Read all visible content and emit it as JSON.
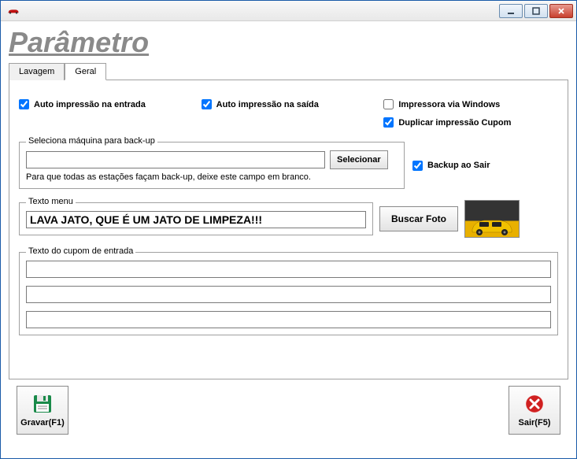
{
  "window": {
    "title": ""
  },
  "page_title": "Parâmetro",
  "tabs": {
    "lavagem": "Lavagem",
    "geral": "Geral"
  },
  "checks": {
    "auto_entrada": {
      "label": "Auto impressão na entrada",
      "checked": true
    },
    "auto_saida": {
      "label": "Auto impressão na saída",
      "checked": true
    },
    "imp_windows": {
      "label": "Impressora via Windows",
      "checked": false
    },
    "dup_cupom": {
      "label": "Duplicar impressão Cupom",
      "checked": true
    },
    "backup_sair": {
      "label": "Backup ao Sair",
      "checked": true
    }
  },
  "backup": {
    "legend": "Seleciona máquina para back-up",
    "value": "",
    "btn": "Selecionar",
    "hint": "Para que todas as  estações façam back-up,        deixe este campo em branco."
  },
  "texto_menu": {
    "legend": "Texto menu",
    "value": "LAVA JATO, QUE É UM JATO DE LIMPEZA!!!",
    "btn_foto": "Buscar Foto"
  },
  "cupom": {
    "legend": "Texto do cupom de entrada",
    "line1": "",
    "line2": "",
    "line3": ""
  },
  "footer": {
    "gravar": "Gravar(F1)",
    "sair": "Sair(F5)"
  }
}
